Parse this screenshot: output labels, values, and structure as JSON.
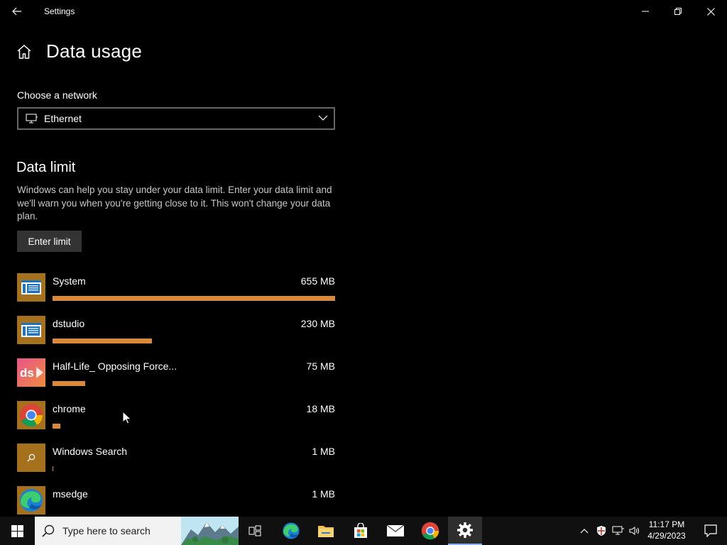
{
  "window": {
    "title": "Settings"
  },
  "page": {
    "title": "Data usage",
    "choose_network_label": "Choose a network",
    "network_selected": "Ethernet"
  },
  "data_limit": {
    "title": "Data limit",
    "description": "Windows can help you stay under your data limit. Enter your data limit and we'll warn you when you're getting close to it. This won't change your data plan.",
    "button_label": "Enter limit"
  },
  "apps": [
    {
      "name": "System",
      "size": "655 MB",
      "usage_fraction": 1.0,
      "icon": "system-app-icon"
    },
    {
      "name": "dstudio",
      "size": "230 MB",
      "usage_fraction": 0.351,
      "icon": "system-app-icon"
    },
    {
      "name": "Half-Life_ Opposing Force...",
      "size": "75 MB",
      "usage_fraction": 0.115,
      "icon": "ds-app-icon"
    },
    {
      "name": "chrome",
      "size": "18 MB",
      "usage_fraction": 0.028,
      "icon": "chrome-icon"
    },
    {
      "name": "Windows Search",
      "size": "1 MB",
      "usage_fraction": 0.003,
      "icon": "search-icon"
    },
    {
      "name": "msedge",
      "size": "1 MB",
      "usage_fraction": 0.003,
      "icon": "edge-icon"
    }
  ],
  "taskbar": {
    "search_placeholder": "Type here to search",
    "time": "11:17 PM",
    "date": "4/29/2023"
  },
  "colors": {
    "accent": "#d9893a",
    "icon_tile": "#a5711d",
    "background": "#000000",
    "taskbar": "#101010"
  }
}
